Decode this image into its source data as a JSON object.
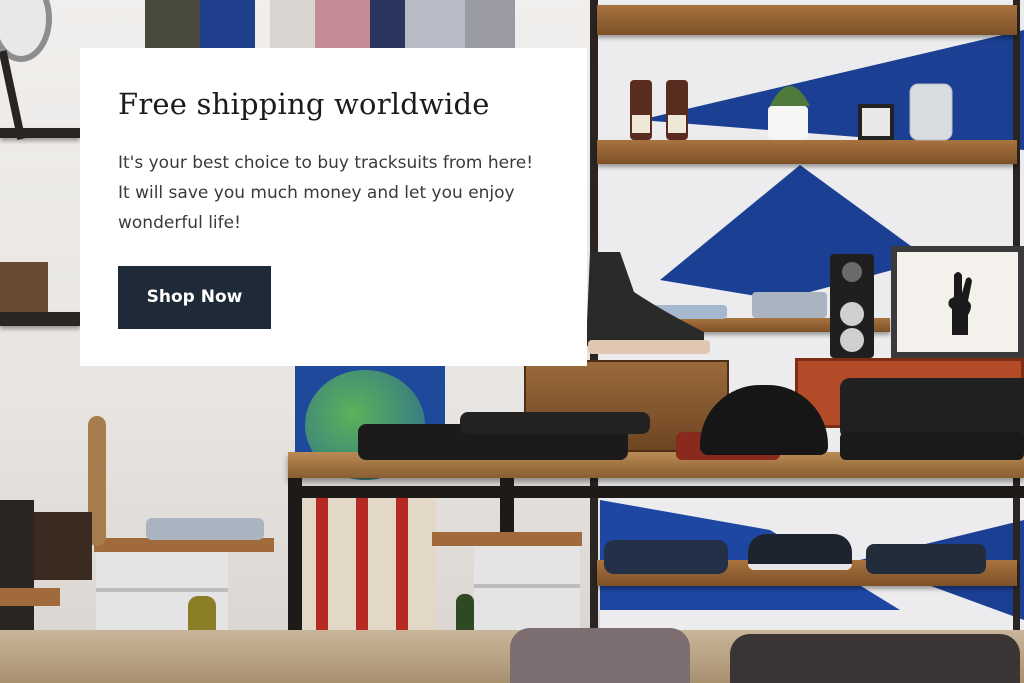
{
  "promo": {
    "title": "Free shipping worldwide",
    "description": "It's your best choice to buy tracksuits from here! It will save you much money and let you enjoy wonderful life!",
    "button_label": "Shop Now"
  },
  "colors": {
    "button_bg": "#1e2a38",
    "button_text": "#ffffff",
    "card_bg": "#ffffff",
    "wall_blue": "#1b3f93"
  },
  "icons": [
    "hand-sign-icon"
  ]
}
